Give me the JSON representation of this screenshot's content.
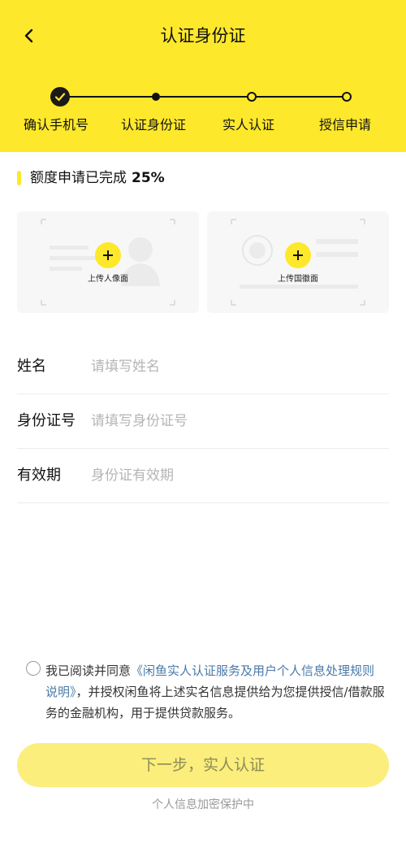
{
  "header": {
    "title": "认证身份证",
    "back_icon": "chevron-left-icon",
    "background": "#fde82b"
  },
  "steps": [
    {
      "label": "确认手机号",
      "state": "done"
    },
    {
      "label": "认证身份证",
      "state": "current"
    },
    {
      "label": "实人认证",
      "state": "pending"
    },
    {
      "label": "授信申请",
      "state": "pending"
    }
  ],
  "progress": {
    "text": "额度申请已完成",
    "percent": "25%"
  },
  "id_cards": {
    "front_label": "上传人像面",
    "back_label": "上传国徽面"
  },
  "form": {
    "name": {
      "label": "姓名",
      "placeholder": "请填写姓名",
      "value": ""
    },
    "id_number": {
      "label": "身份证号",
      "placeholder": "请填写身份证号",
      "value": ""
    },
    "validity": {
      "label": "有效期",
      "placeholder": "身份证有效期",
      "value": ""
    }
  },
  "agreement": {
    "checked": false,
    "prefix": "我已阅读并同意",
    "link": "《闲鱼实人认证服务及用户个人信息处理规则说明》",
    "suffix": "，并授权闲鱼将上述实名信息提供给为您提供授信/借款服务的金融机构，用于提供贷款服务。"
  },
  "next_button": {
    "label": "下一步，实人认证"
  },
  "footer_note": "个人信息加密保护中"
}
